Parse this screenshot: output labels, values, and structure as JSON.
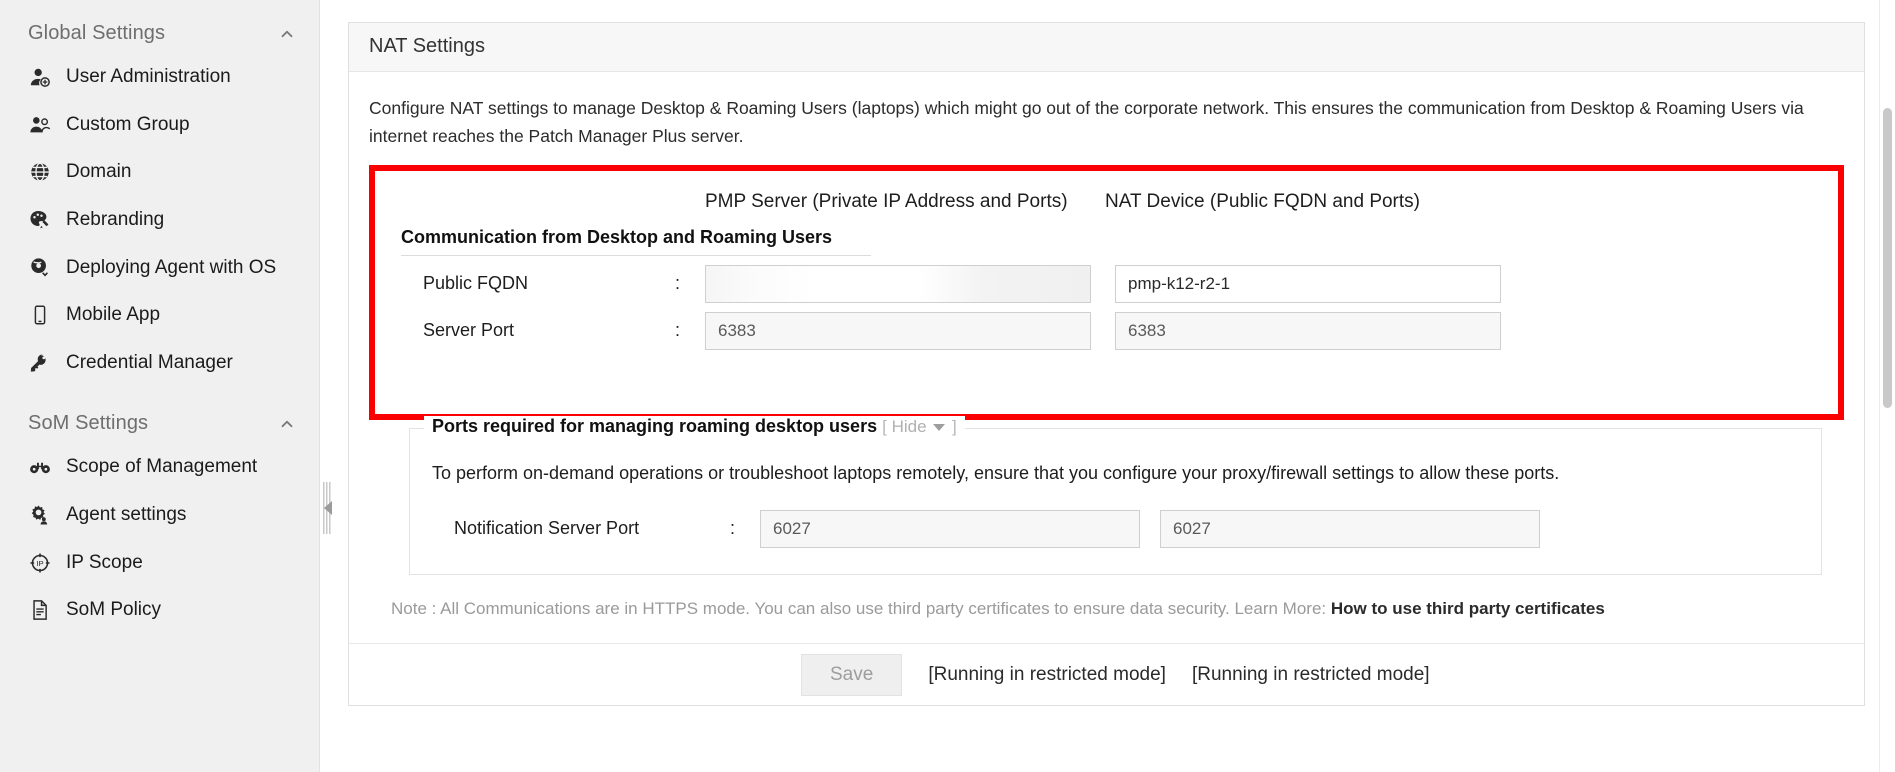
{
  "sidebar": {
    "sections": [
      {
        "title": "Global Settings",
        "chevron": "chevron-up-icon",
        "items": [
          {
            "label": "User Administration",
            "icon": "user-add-icon"
          },
          {
            "label": "Custom Group",
            "icon": "users-group-icon"
          },
          {
            "label": "Domain",
            "icon": "globe-icon"
          },
          {
            "label": "Rebranding",
            "icon": "palette-brush-icon"
          },
          {
            "label": "Deploying Agent with OS",
            "icon": "agent-deploy-icon"
          },
          {
            "label": "Mobile App",
            "icon": "mobile-phone-icon"
          },
          {
            "label": "Credential Manager",
            "icon": "key-icon"
          }
        ]
      },
      {
        "title": "SoM Settings",
        "chevron": "chevron-up-icon",
        "items": [
          {
            "label": "Scope of Management",
            "icon": "binoculars-icon"
          },
          {
            "label": "Agent settings",
            "icon": "gear-user-icon"
          },
          {
            "label": "IP Scope",
            "icon": "ip-target-icon"
          },
          {
            "label": "SoM Policy",
            "icon": "document-icon"
          }
        ]
      }
    ],
    "collapse_handle": "sidebar-collapse-handle"
  },
  "card": {
    "title": "NAT Settings",
    "description": "Configure NAT settings to manage Desktop & Roaming Users (laptops) which might go out of the corporate network. This ensures the communication from Desktop & Roaming Users via internet reaches the Patch Manager Plus server."
  },
  "highlight": {
    "color": "#fb0000",
    "column_headers": {
      "spacer": "",
      "pmp_server": "PMP Server (Private IP Address and Ports)",
      "nat_device": "NAT Device (Public FQDN and Ports)"
    },
    "subsection_title": "Communication from Desktop and Roaming Users",
    "rows": [
      {
        "label": "Public FQDN",
        "colon": ":",
        "pmp_value": "",
        "pmp_masked": true,
        "nat_value": "pmp-k12-r2-1"
      },
      {
        "label": "Server Port",
        "colon": ":",
        "pmp_value": "6383",
        "pmp_masked": false,
        "nat_value": "6383"
      }
    ]
  },
  "fieldset": {
    "legend": "Ports required for managing roaming desktop users",
    "toggle_open": "[",
    "toggle_label": "Hide",
    "toggle_close": "]",
    "caret": "caret-down-icon",
    "text": "To perform on-demand operations or troubleshoot laptops remotely, ensure that you configure your proxy/firewall settings to allow these ports.",
    "rows": [
      {
        "label": "Notification Server Port",
        "colon": ":",
        "pmp_value": "6027",
        "nat_value": "6027"
      }
    ]
  },
  "note": {
    "prefix": "Note : ",
    "body": "All Communications are in HTTPS mode. You can also use third party certificates to ensure data security. Learn More: ",
    "link": "How to use third party certificates"
  },
  "footer": {
    "save_label": "Save",
    "status_1": "[Running in restricted mode]",
    "status_2": "[Running in restricted mode]"
  }
}
